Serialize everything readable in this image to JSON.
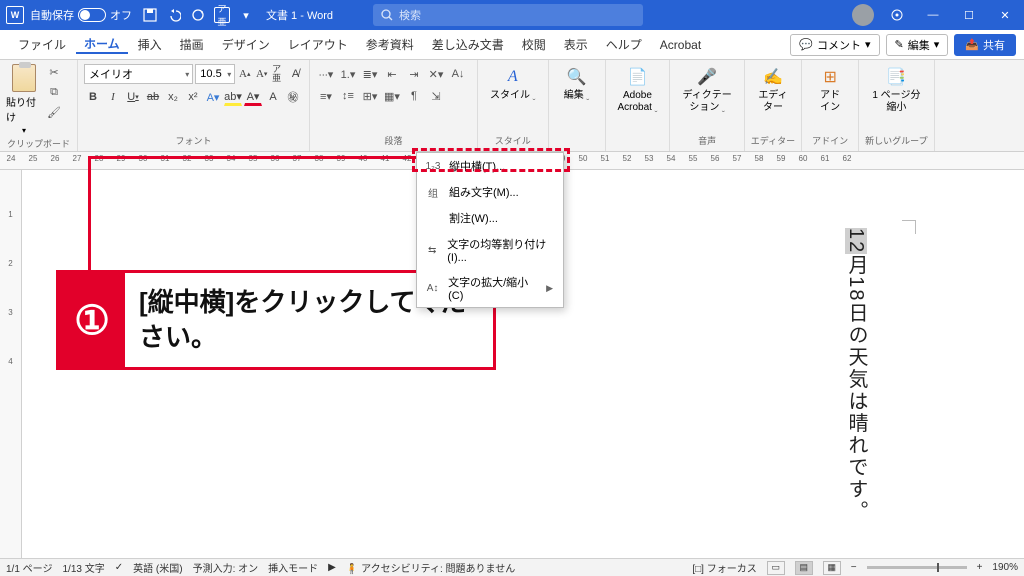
{
  "titlebar": {
    "autosave_label": "自動保存",
    "autosave_state": "オフ",
    "doc_title": "文書 1 - Word",
    "search_placeholder": "検索"
  },
  "tabs": {
    "items": [
      "ファイル",
      "ホーム",
      "挿入",
      "描画",
      "デザイン",
      "レイアウト",
      "参考資料",
      "差し込み文書",
      "校閲",
      "表示",
      "ヘルプ",
      "Acrobat"
    ],
    "active_index": 1,
    "comment_btn": "コメント",
    "edit_btn": "編集",
    "share_btn": "共有"
  },
  "ribbon": {
    "clipboard": {
      "paste": "貼り付け",
      "group_label": "クリップボード"
    },
    "font": {
      "name": "メイリオ",
      "size": "10.5",
      "group_label": "フォント",
      "phon": "ア亜"
    },
    "paragraph": {
      "group_label": "段落"
    },
    "styles": {
      "btn": "スタイル",
      "group_label": "スタイル"
    },
    "editing": {
      "btn": "編集"
    },
    "acrobat": {
      "btn": "Adobe\nAcrobat"
    },
    "dictate": {
      "btn": "ディクテー\nション",
      "group_label": "音声"
    },
    "editor": {
      "btn": "エディ\nター",
      "group_label": "エディター"
    },
    "addin": {
      "btn": "アド\nイン",
      "group_label": "アドイン"
    },
    "pageshrink": {
      "btn": "1 ページ分\n縮小",
      "group_label": "新しいグループ"
    }
  },
  "ruler_start": 24,
  "ruler_end": 62,
  "context_menu": {
    "items": [
      {
        "icon": "1₂3",
        "label": "縦中横(T)..."
      },
      {
        "icon": "组",
        "label": "組み文字(M)..."
      },
      {
        "icon": "",
        "label": "割注(W)..."
      },
      {
        "icon": "⇆",
        "label": "文字の均等割り付け(I)..."
      },
      {
        "icon": "A↕",
        "label": "文字の拡大/縮小(C)",
        "submenu": true
      }
    ]
  },
  "document": {
    "selected": "12",
    "rest": "月18日の天気は晴れです。"
  },
  "annotation": {
    "num": "①",
    "text": "[縦中横]をクリックしてください。"
  },
  "status": {
    "page": "1/1 ページ",
    "chars": "1/13 文字",
    "lang": "英語 (米国)",
    "predict": "予測入力: オン",
    "insert": "挿入モード",
    "access": "アクセシビリティ: 問題ありません",
    "focus": "フォーカス",
    "zoom": "190%"
  }
}
